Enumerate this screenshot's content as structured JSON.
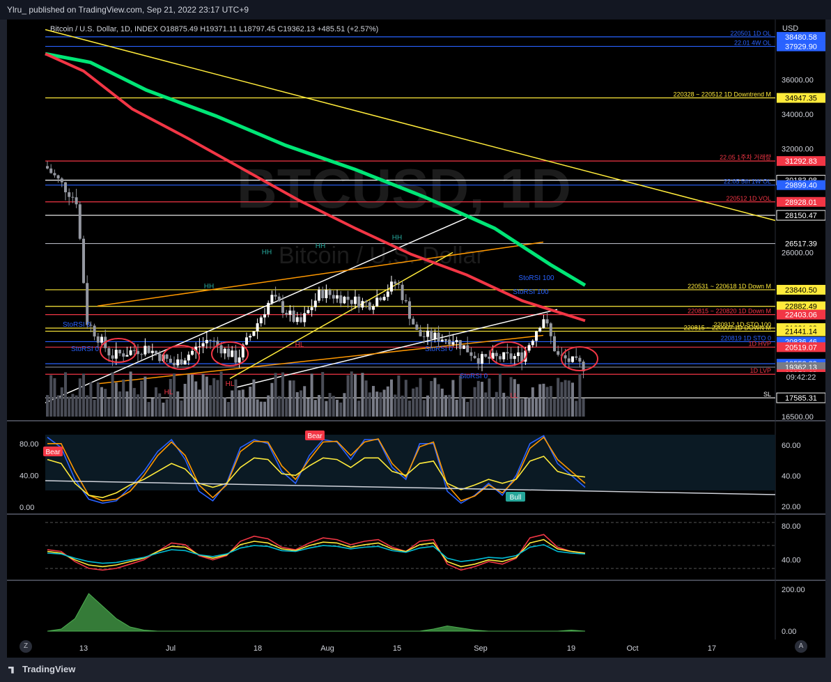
{
  "header": {
    "publish_line": "Ylru_ published on TradingView.com, Sep 21, 2022 23:17 UTC+9"
  },
  "chart": {
    "legend": "Bitcoin / U.S. Dollar, 1D, INDEX  O18875.49  H19371.11  L18797.45  C19362.13  +485.51 (+2.57%)",
    "watermark_symbol": "BTCUSD, 1D",
    "watermark_name": "Bitcoin / U.S. Dollar",
    "currency": "USD"
  },
  "chart_data": [
    {
      "type": "candlestick",
      "symbol": "BTCUSD",
      "interval": "1D",
      "ohlc_last": {
        "open": 18875.49,
        "high": 19371.11,
        "low": 18797.45,
        "close": 19362.13,
        "change": 485.51,
        "change_pct": 2.57
      },
      "ylim": [
        16500,
        39000
      ],
      "x_tick_labels": [
        "13",
        "Jul",
        "18",
        "Aug",
        "15",
        "Sep",
        "19",
        "Oct",
        "17"
      ],
      "y_tick_labels": [
        "36000.00",
        "34000.00",
        "32000.00",
        "26000.00",
        "16500.00"
      ],
      "price_lines": [
        {
          "label": "220501 1D OL",
          "value": 38480.58,
          "color": "#2962ff"
        },
        {
          "label": "22.01 4W OL",
          "value": 37929.9,
          "color": "#2962ff"
        },
        {
          "label": "220328 ~ 220512 1D Downtrend M",
          "value": 34947.35,
          "color": "#ffeb3b"
        },
        {
          "label": "22.05 1주차 거래량",
          "value": 31292.83,
          "color": "#f23645"
        },
        {
          "label": "",
          "value": 30183.98,
          "color": "#ffffff"
        },
        {
          "label": "22.05 5th 1W OL",
          "value": 29899.4,
          "color": "#2962ff"
        },
        {
          "label": "220512 1D VOL",
          "value": 28928.01,
          "color": "#f23645"
        },
        {
          "label": "",
          "value": 28150.47,
          "color": "#ffffff"
        },
        {
          "label": "",
          "value": 26517.39,
          "color": "#b2b5be"
        },
        {
          "label": "220531 ~ 220618 1D Down M",
          "value": 23840.5,
          "color": "#ffeb3b"
        },
        {
          "label": "",
          "value": 22882.49,
          "color": "#ffeb3b"
        },
        {
          "label": "220815 ~ 220820 1D Down M",
          "value": 22403.06,
          "color": "#f23645"
        },
        {
          "label": "220912 1D STO 100",
          "value": 21621.08,
          "color": "#ffeb3b"
        },
        {
          "label": "220815 ~ 220907 1D DOWN M",
          "value": 21441.14,
          "color": "#ffeb3b"
        },
        {
          "label": "220819 1D STO 0",
          "value": 20836.46,
          "color": "#2962ff"
        },
        {
          "label": "1D HVP",
          "value": 20519.07,
          "color": "#f23645"
        },
        {
          "label": "",
          "value": 19558.89,
          "color": "#2962ff"
        },
        {
          "label": "",
          "value": 19362.13,
          "color": "#787b86"
        },
        {
          "label": "1D LVP",
          "value": 18951.09,
          "color": "#f23645"
        },
        {
          "label": "SL",
          "value": 17585.31,
          "color": "#ffffff"
        }
      ],
      "countdown": "09:42:22",
      "annotations": [
        "StoRSI 0",
        "StoRSI 0",
        "StoRSI 0",
        "StoRSI 0",
        "StoRSI 100",
        "StoRSI 100",
        "HH",
        "HH",
        "HH",
        "HH",
        "HL",
        "HL",
        "HL",
        "LL"
      ]
    },
    {
      "type": "line",
      "title": "",
      "y_tick_labels": [
        "80.00",
        "40.00",
        "0.00"
      ],
      "y_tick_labels_right": [
        "60.00",
        "40.00",
        "20.00"
      ],
      "labels": [
        "Bear",
        "Bear",
        "Bull"
      ],
      "series": [
        {
          "color": "#2962ff",
          "values": [
            88,
            75,
            35,
            10,
            5,
            8,
            25,
            45,
            70,
            85,
            60,
            20,
            8,
            30,
            75,
            85,
            80,
            45,
            30,
            65,
            85,
            82,
            60,
            85,
            85,
            50,
            35,
            80,
            80,
            20,
            5,
            15,
            30,
            15,
            40,
            80,
            90,
            55,
            40,
            25
          ]
        },
        {
          "color": "#ff9800",
          "values": [
            80,
            80,
            45,
            15,
            8,
            10,
            20,
            40,
            65,
            82,
            65,
            28,
            12,
            28,
            70,
            83,
            82,
            52,
            35,
            60,
            82,
            83,
            65,
            82,
            86,
            55,
            38,
            76,
            82,
            28,
            8,
            14,
            28,
            18,
            36,
            74,
            88,
            60,
            45,
            30
          ]
        },
        {
          "color": "#ffeb3b",
          "values": [
            60,
            55,
            30,
            15,
            12,
            18,
            28,
            35,
            45,
            55,
            48,
            30,
            25,
            30,
            50,
            62,
            60,
            42,
            40,
            52,
            62,
            60,
            50,
            62,
            62,
            45,
            40,
            55,
            58,
            30,
            22,
            28,
            35,
            30,
            35,
            58,
            64,
            45,
            40,
            38
          ]
        }
      ]
    },
    {
      "type": "line",
      "title": "",
      "y_tick_labels": [
        "80.00",
        "40.00"
      ],
      "series": [
        {
          "color": "#f23645",
          "values": [
            52,
            50,
            38,
            30,
            28,
            30,
            35,
            40,
            50,
            60,
            58,
            45,
            40,
            45,
            62,
            68,
            65,
            55,
            52,
            60,
            66,
            64,
            58,
            62,
            64,
            55,
            50,
            62,
            64,
            35,
            28,
            32,
            38,
            35,
            42,
            66,
            70,
            55,
            50,
            48
          ]
        },
        {
          "color": "#ffeb3b",
          "values": [
            50,
            48,
            40,
            34,
            32,
            34,
            38,
            42,
            50,
            56,
            55,
            46,
            42,
            46,
            58,
            62,
            60,
            53,
            51,
            57,
            61,
            60,
            55,
            58,
            60,
            53,
            50,
            58,
            60,
            38,
            32,
            35,
            40,
            38,
            43,
            60,
            64,
            53,
            50,
            48
          ]
        },
        {
          "color": "#00bcd4",
          "values": [
            48,
            47,
            42,
            38,
            36,
            37,
            40,
            43,
            48,
            52,
            51,
            46,
            44,
            47,
            54,
            57,
            56,
            51,
            50,
            54,
            57,
            56,
            53,
            55,
            56,
            51,
            49,
            54,
            56,
            42,
            38,
            40,
            43,
            42,
            45,
            55,
            58,
            50,
            48,
            47
          ]
        }
      ]
    },
    {
      "type": "area",
      "title": "",
      "y_tick_labels": [
        "200.00",
        "0.00"
      ],
      "series": [
        {
          "color": "#4caf50",
          "values": [
            0,
            10,
            60,
            180,
            120,
            60,
            20,
            5,
            0,
            0,
            0,
            0,
            0,
            0,
            0,
            0,
            0,
            0,
            0,
            0,
            0,
            0,
            0,
            0,
            0,
            0,
            0,
            0,
            10,
            25,
            15,
            5,
            0,
            0,
            0,
            0,
            0,
            0,
            5,
            0
          ]
        }
      ]
    }
  ],
  "footer": {
    "brand": "TradingView",
    "left_button": "Z",
    "right_button": "A"
  },
  "colors": {
    "background": "#000000",
    "up": "#ffffff",
    "down": "#b2b5be",
    "ma_fast": "#f23645",
    "ma_slow": "#00e676"
  }
}
